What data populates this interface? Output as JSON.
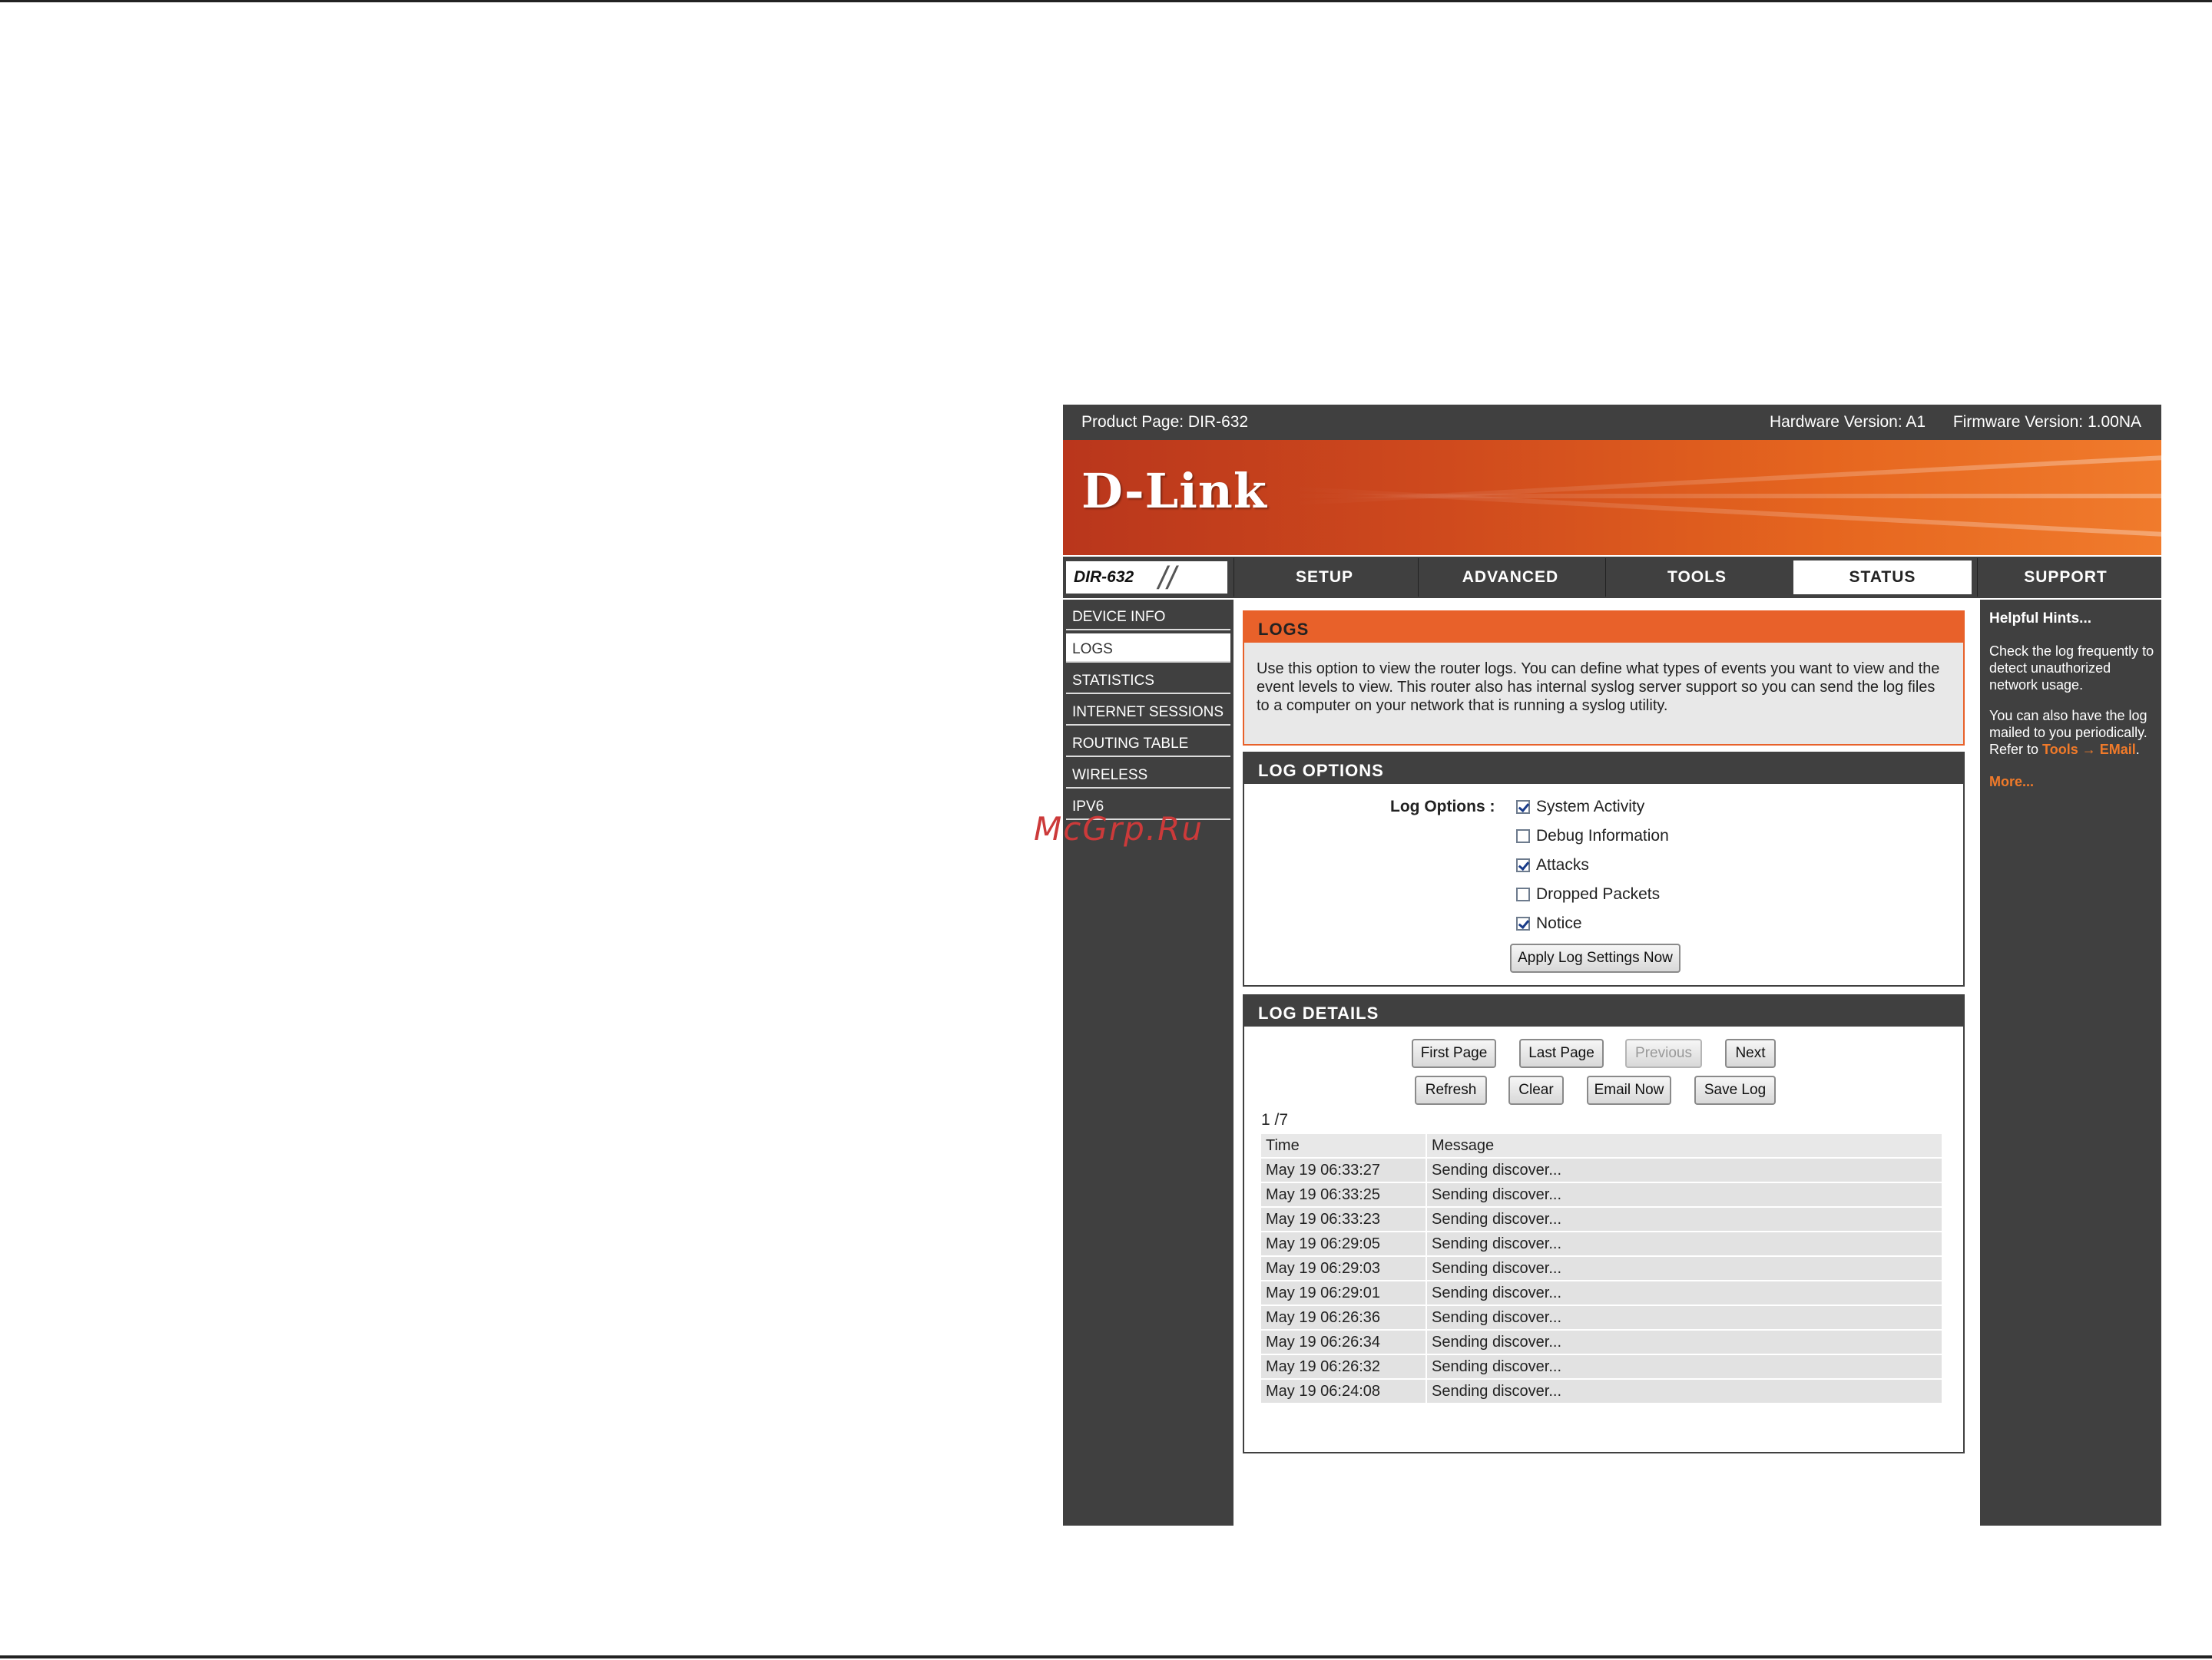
{
  "watermark": "McGrp.Ru",
  "topbar": {
    "product": "Product Page: DIR-632",
    "hardware": "Hardware Version: A1",
    "firmware": "Firmware Version: 1.00NA"
  },
  "brand": {
    "logo": "D-Link",
    "accent": "#e8612a",
    "dark": "#404040"
  },
  "model": "DIR-632",
  "tabs": [
    {
      "label": "SETUP"
    },
    {
      "label": "ADVANCED"
    },
    {
      "label": "TOOLS"
    },
    {
      "label": "STATUS"
    },
    {
      "label": "SUPPORT"
    }
  ],
  "sidebar": {
    "items": [
      {
        "label": "DEVICE INFO"
      },
      {
        "label": "LOGS"
      },
      {
        "label": "STATISTICS"
      },
      {
        "label": "INTERNET SESSIONS"
      },
      {
        "label": "ROUTING TABLE"
      },
      {
        "label": "WIRELESS"
      },
      {
        "label": "IPV6"
      }
    ]
  },
  "logs": {
    "title": "LOGS",
    "description": "Use this option to view the router logs. You can define what types of events you want to view and the event levels to view. This router also has internal syslog server support so you can send the log files to a computer on your network that is running a syslog utility."
  },
  "log_options": {
    "title": "LOG OPTIONS",
    "label": "Log Options :",
    "options": [
      {
        "label": "System Activity",
        "checked": true
      },
      {
        "label": "Debug Information",
        "checked": false
      },
      {
        "label": "Attacks",
        "checked": true
      },
      {
        "label": "Dropped Packets",
        "checked": false
      },
      {
        "label": "Notice",
        "checked": true
      }
    ],
    "apply_button": "Apply Log Settings Now"
  },
  "log_details": {
    "title": "LOG DETAILS",
    "buttons": {
      "first": "First Page",
      "last": "Last Page",
      "previous": "Previous",
      "next": "Next",
      "refresh": "Refresh",
      "clear": "Clear",
      "email": "Email Now",
      "save": "Save Log"
    },
    "page_indicator": "1 /7",
    "columns": [
      "Time",
      "Message"
    ],
    "rows": [
      {
        "time": "May 19 06:33:27",
        "message": "Sending discover..."
      },
      {
        "time": "May 19 06:33:25",
        "message": "Sending discover..."
      },
      {
        "time": "May 19 06:33:23",
        "message": "Sending discover..."
      },
      {
        "time": "May 19 06:29:05",
        "message": "Sending discover..."
      },
      {
        "time": "May 19 06:29:03",
        "message": "Sending discover..."
      },
      {
        "time": "May 19 06:29:01",
        "message": "Sending discover..."
      },
      {
        "time": "May 19 06:26:36",
        "message": "Sending discover..."
      },
      {
        "time": "May 19 06:26:34",
        "message": "Sending discover..."
      },
      {
        "time": "May 19 06:26:32",
        "message": "Sending discover..."
      },
      {
        "time": "May 19 06:24:08",
        "message": "Sending discover..."
      }
    ]
  },
  "hints": {
    "title": "Helpful Hints...",
    "p1": "Check the log frequently to detect unauthorized network usage.",
    "p2": "You can also have the log mailed to you periodically. Refer to",
    "link": "Tools → EMail",
    "p2_end": ".",
    "more": "More..."
  }
}
